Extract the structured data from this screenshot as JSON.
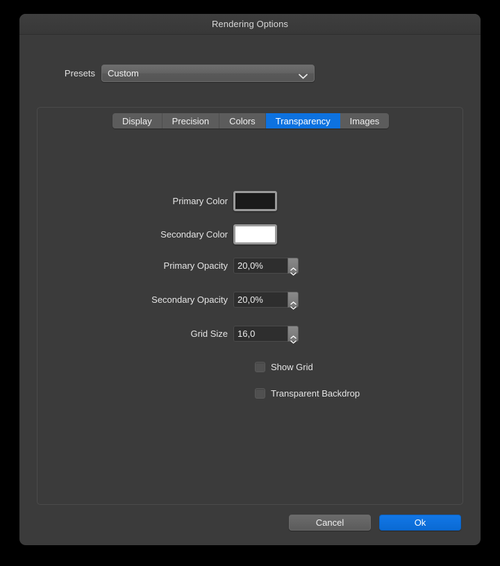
{
  "window": {
    "title": "Rendering Options"
  },
  "presets": {
    "label": "Presets",
    "value": "Custom",
    "chevron_icon": "chevron-down-icon"
  },
  "tabs": [
    {
      "label": "Display",
      "selected": false
    },
    {
      "label": "Precision",
      "selected": false
    },
    {
      "label": "Colors",
      "selected": false
    },
    {
      "label": "Transparency",
      "selected": true
    },
    {
      "label": "Images",
      "selected": false
    }
  ],
  "fields": {
    "primary_color": {
      "label": "Primary Color",
      "swatch_color": "#1a1a1a"
    },
    "secondary_color": {
      "label": "Secondary Color",
      "swatch_color": "#ffffff"
    },
    "primary_opacity": {
      "label": "Primary Opacity",
      "value": "20,0%"
    },
    "secondary_opacity": {
      "label": "Secondary Opacity",
      "value": "20,0%"
    },
    "grid_size": {
      "label": "Grid Size",
      "value": "16,0"
    }
  },
  "checkboxes": [
    {
      "label": "Show Grid",
      "checked": false
    },
    {
      "label": "Transparent Backdrop",
      "checked": false
    }
  ],
  "footer": {
    "cancel_label": "Cancel",
    "ok_label": "Ok"
  },
  "colors": {
    "accent": "#0d72e0",
    "window_background": "#3b3b3b",
    "titlebar": "#3a3a3a",
    "outer_background": "#000000"
  }
}
